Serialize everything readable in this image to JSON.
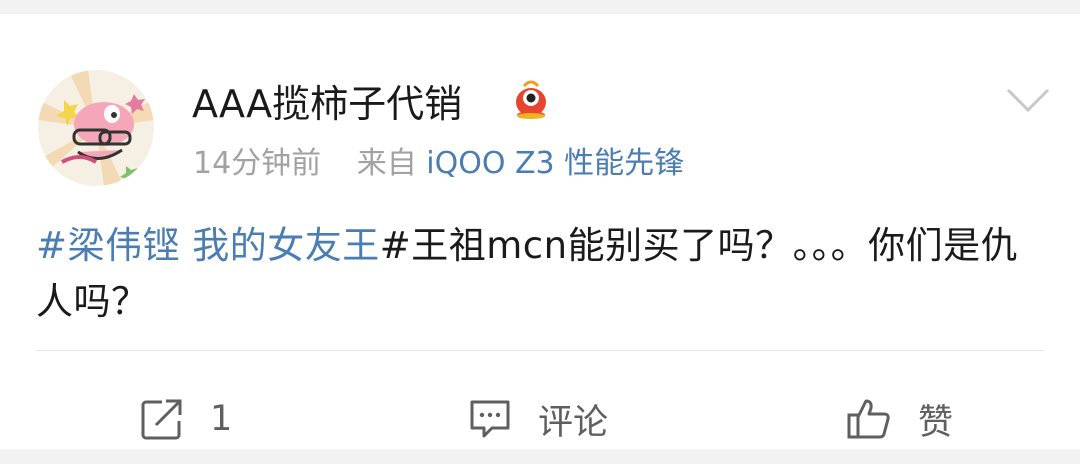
{
  "post": {
    "username": "AAA揽柿子代销",
    "time": "14分钟前",
    "source_prefix": "来自",
    "device": "iQOO Z3 性能先锋",
    "hashtag": "#梁伟铿 我的女友王",
    "text_rest": "#王祖mcn能别买了吗？。。。你们是仇人吗？"
  },
  "actions": {
    "repost_count": "1",
    "comment_label": "评论",
    "like_label": "赞"
  },
  "colors": {
    "link": "#4a7db4",
    "text": "#1a1a1a",
    "meta": "#a2a2a2",
    "icon": "#5f5f5f"
  }
}
